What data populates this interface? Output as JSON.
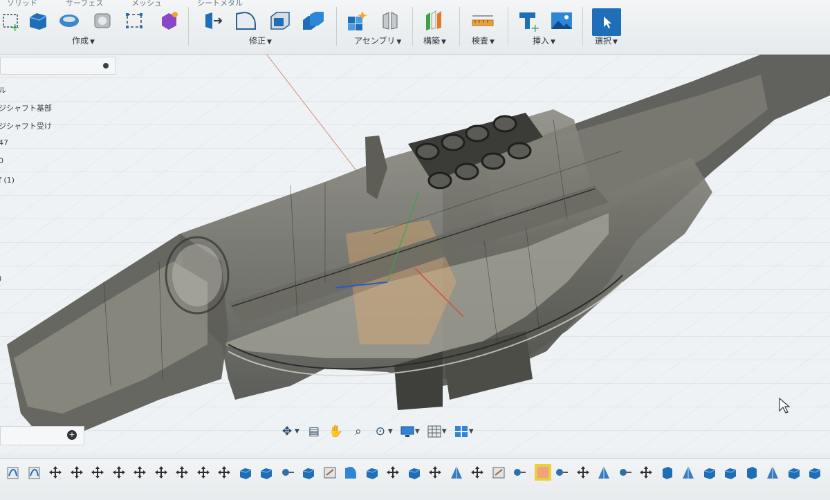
{
  "toolbar": {
    "tabs": [
      "ソリッド",
      "サーフェス",
      "メッシュ",
      "シートメタル"
    ],
    "groups": {
      "create": "作成",
      "modify": "修正",
      "assemble": "アセンブリ",
      "construct": "構築",
      "inspect": "検査",
      "insert": "挿入",
      "select": "選択"
    }
  },
  "browser": {
    "items": [
      "ル",
      "ジシャフト基部",
      "ジシャフト受け",
      "47",
      "0",
      "ƒ (1)",
      "",
      ")"
    ]
  },
  "colors": {
    "accent": "#1e6fb8",
    "body_dark": "#4a4b46",
    "body_light": "#8b8a80",
    "highlight_orange": "#f0b36b"
  },
  "navbar": {
    "icons": [
      "orbit-icon",
      "look-at-icon",
      "pan-icon",
      "zoom-icon",
      "zoom-window-icon",
      "display-settings-icon",
      "grid-icon",
      "viewports-icon"
    ]
  },
  "timeline": {
    "icons": [
      "sketch",
      "sketch",
      "move",
      "move",
      "move",
      "move",
      "move",
      "move",
      "move",
      "move",
      "move",
      "extrude",
      "extrude",
      "joint",
      "extrude",
      "sketch-plane",
      "fillet",
      "extrude",
      "move",
      "extrude",
      "move",
      "draft",
      "move",
      "sketch-plane",
      "joint",
      "active-feature",
      "joint",
      "move",
      "draft",
      "joint",
      "move",
      "box",
      "draft",
      "extrude",
      "extrude",
      "box",
      "draft",
      "extrude",
      "extrude"
    ]
  }
}
